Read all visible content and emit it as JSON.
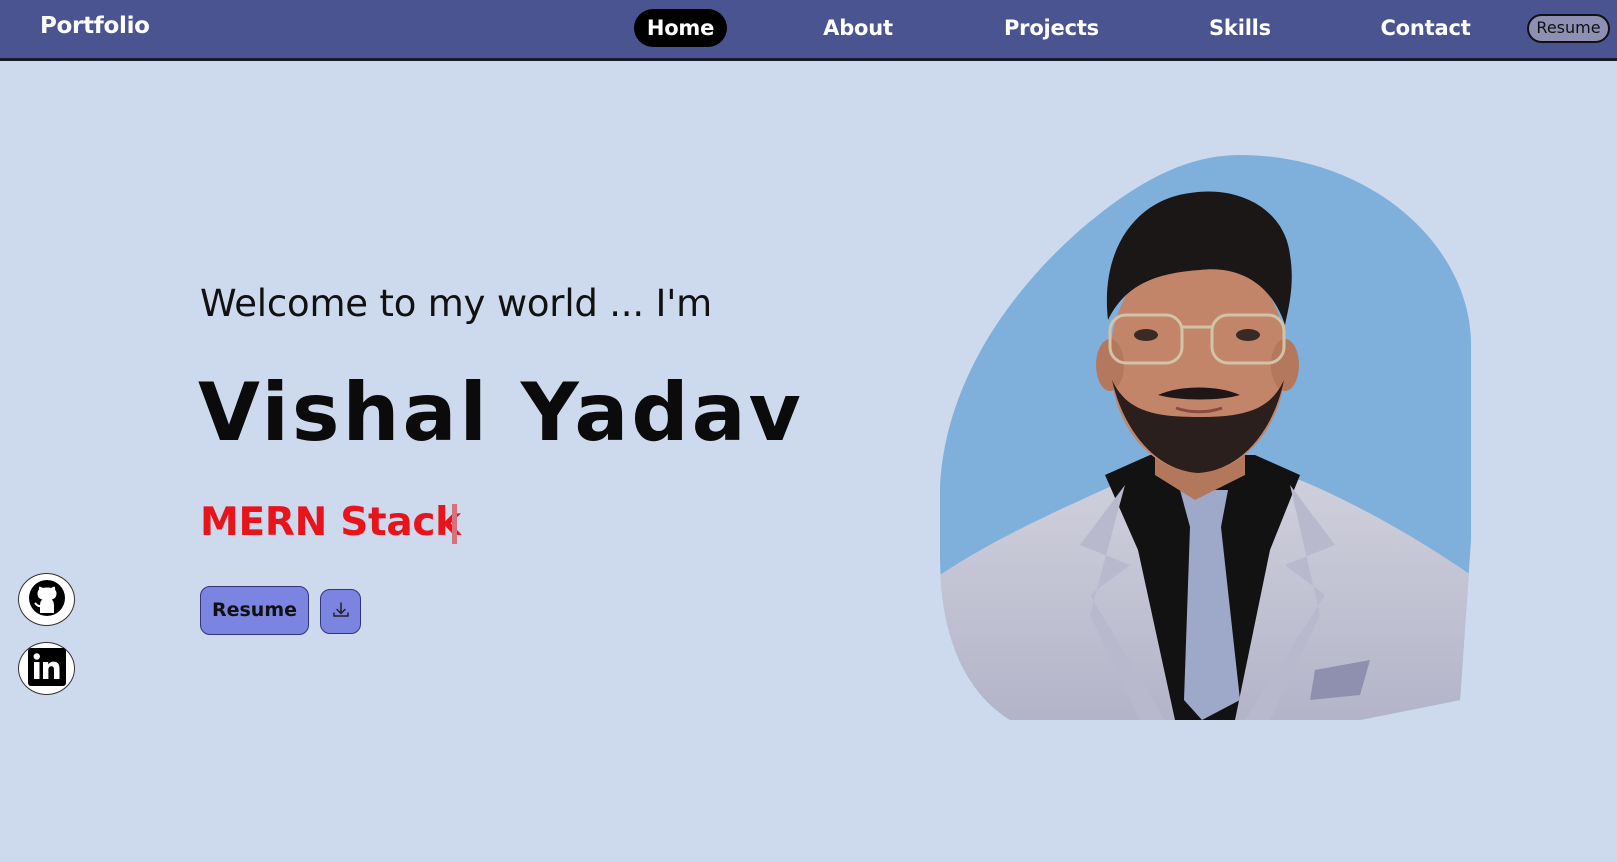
{
  "nav": {
    "brand": "Portfolio",
    "links": [
      "Home",
      "About",
      "Projects",
      "Skills",
      "Contact"
    ],
    "active": "Home",
    "resume_label": "Resume"
  },
  "hero": {
    "greeting": "Welcome to my world ... I'm",
    "name": "Vishal Yadav",
    "role": "MERN Stack",
    "resume_button": "Resume"
  },
  "icons": {
    "download": "download-icon",
    "github": "github-icon",
    "linkedin": "linkedin-icon",
    "portrait": "profile-photo"
  },
  "colors": {
    "nav_bg": "#4a5491",
    "page_bg": "#cdd9ed",
    "role_text": "#e8141b",
    "button_bg": "#7b84e0",
    "portrait_blob": "#7fb0dc"
  }
}
